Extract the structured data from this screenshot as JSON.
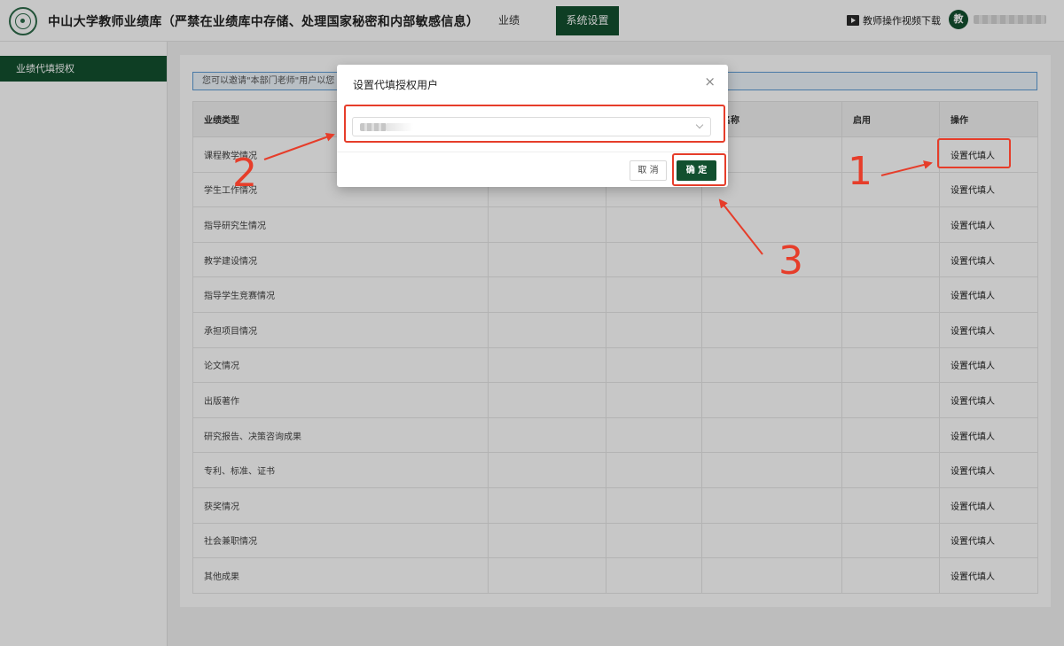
{
  "header": {
    "app_title": "中山大学教师业绩库（严禁在业绩库中存储、处理国家秘密和内部敏感信息）",
    "nav": [
      {
        "label": "业绩"
      },
      {
        "label": "系统设置",
        "active": true
      }
    ],
    "video_link_label": "教师操作视频下载",
    "avatar_text": "教"
  },
  "sidebar": {
    "items": [
      {
        "label": "业绩代填授权",
        "active": true
      }
    ]
  },
  "notice_text": "您可以邀请\"本部门老师\"用户以您",
  "table": {
    "columns": [
      "业绩类型",
      "",
      "",
      "门名称",
      "启用",
      "操作"
    ],
    "rows": [
      {
        "type": "课程教学情况",
        "action": "设置代填人"
      },
      {
        "type": "学生工作情况",
        "action": "设置代填人"
      },
      {
        "type": "指导研究生情况",
        "action": "设置代填人"
      },
      {
        "type": "教学建设情况",
        "action": "设置代填人"
      },
      {
        "type": "指导学生竞赛情况",
        "action": "设置代填人"
      },
      {
        "type": "承担项目情况",
        "action": "设置代填人"
      },
      {
        "type": "论文情况",
        "action": "设置代填人"
      },
      {
        "type": "出版著作",
        "action": "设置代填人"
      },
      {
        "type": "研究报告、决策咨询成果",
        "action": "设置代填人"
      },
      {
        "type": "专利、标准、证书",
        "action": "设置代填人"
      },
      {
        "type": "获奖情况",
        "action": "设置代填人"
      },
      {
        "type": "社会兼职情况",
        "action": "设置代填人"
      },
      {
        "type": "其他成果",
        "action": "设置代填人"
      }
    ]
  },
  "modal": {
    "title": "设置代填授权用户",
    "close_symbol": "×",
    "cancel_label": "取 消",
    "ok_label": "确 定"
  },
  "annotations": {
    "step1": "1",
    "step2": "2",
    "step3": "3",
    "color": "#e63d2a"
  },
  "colors": {
    "brand_green": "#12502f",
    "notice_border": "#5b9bd5"
  }
}
